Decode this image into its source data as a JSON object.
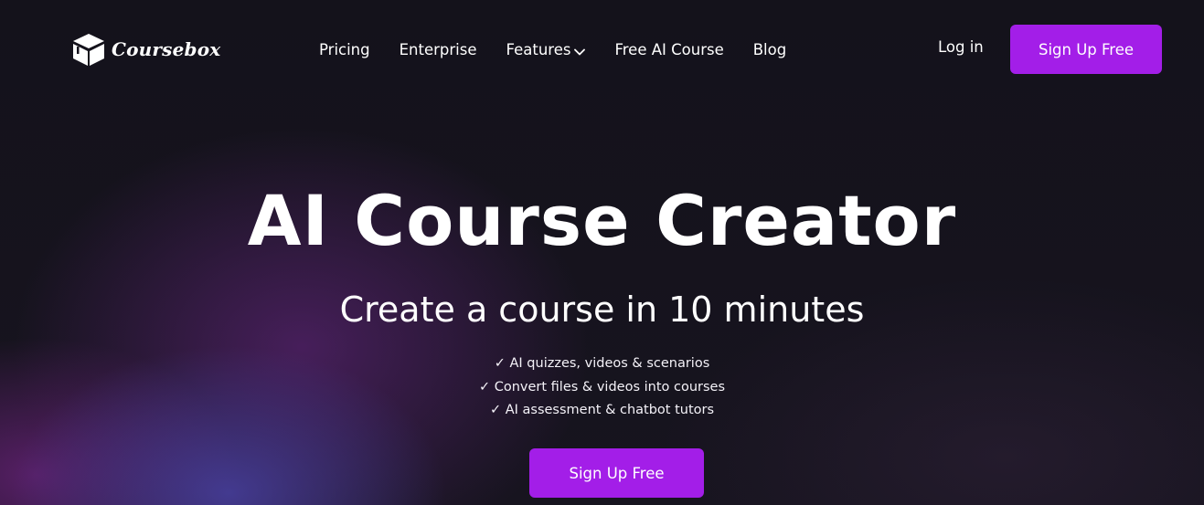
{
  "brand": {
    "name": "Coursebox",
    "logo_icon": "box-icon"
  },
  "nav": {
    "items": [
      {
        "label": "Pricing"
      },
      {
        "label": "Enterprise"
      },
      {
        "label": "Features",
        "icon": "chevron-down-icon"
      },
      {
        "label": "Free AI Course"
      },
      {
        "label": "Blog"
      }
    ]
  },
  "header": {
    "login_label": "Log in",
    "signup_label": "Sign Up Free"
  },
  "hero": {
    "title": "AI Course Creator",
    "subtitle": "Create a course in 10 minutes",
    "features": [
      "✓ AI quizzes, videos & scenarios",
      "✓ Convert files & videos into courses",
      "✓ AI assessment & chatbot tutors"
    ],
    "cta_label": "Sign Up Free"
  },
  "colors": {
    "accent": "#a31ee8",
    "background": "#14121c"
  }
}
